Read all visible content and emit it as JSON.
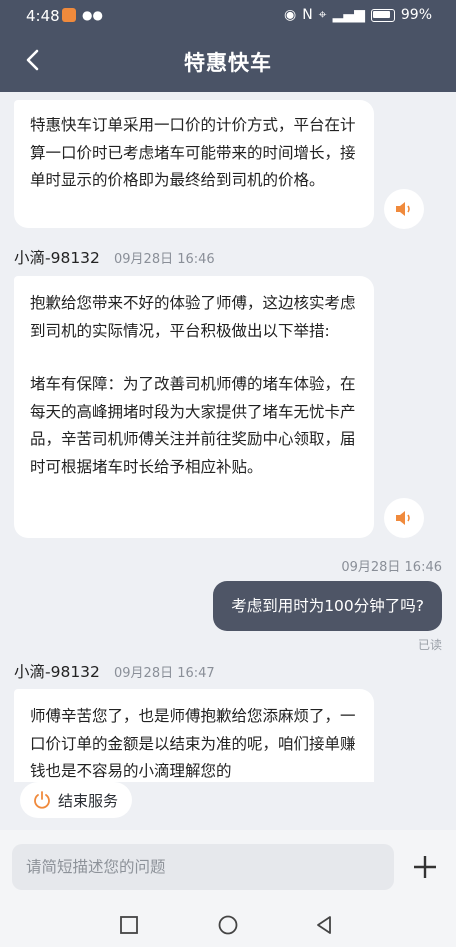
{
  "status_bar": {
    "time": "4:48",
    "battery": "99%"
  },
  "header": {
    "title": "特惠快车"
  },
  "messages": {
    "m1": "特惠快车订单采用一口价的计价方式，平台在计算一口价时已考虑堵车可能带来的时间增长，接单时显示的价格即为最终给到司机的价格。",
    "m2_sender": "小滴-98132",
    "m2_time": "09月28日 16:46",
    "m2_p1": "抱歉给您带来不好的体验了师傅，这边核实考虑到司机的实际情况，平台积极做出以下举措:",
    "m2_p2": "堵车有保障：为了改善司机师傅的堵车体验，在每天的高峰拥堵时段为大家提供了堵车无忧卡产品，辛苦司机师傅关注并前往奖励中心领取，届时可根据堵车时长给予相应补贴。",
    "m3_time": "09月28日 16:46",
    "m3_text": "考虑到用时为100分钟了吗?",
    "m3_read": "已读",
    "m4_sender": "小滴-98132",
    "m4_time": "09月28日 16:47",
    "m4_text": "师傅辛苦您了，也是师傅抱歉给您添麻烦了，一口价订单的金额是以结束为准的呢，咱们接单赚钱也是不容易的小滴理解您的"
  },
  "end_service": {
    "label": "结束服务"
  },
  "input": {
    "placeholder": "请简短描述您的问题"
  },
  "colors": {
    "header_bg": "#4a5366",
    "my_bubble": "#4e5566",
    "speaker_orange": "#f08a3c"
  }
}
